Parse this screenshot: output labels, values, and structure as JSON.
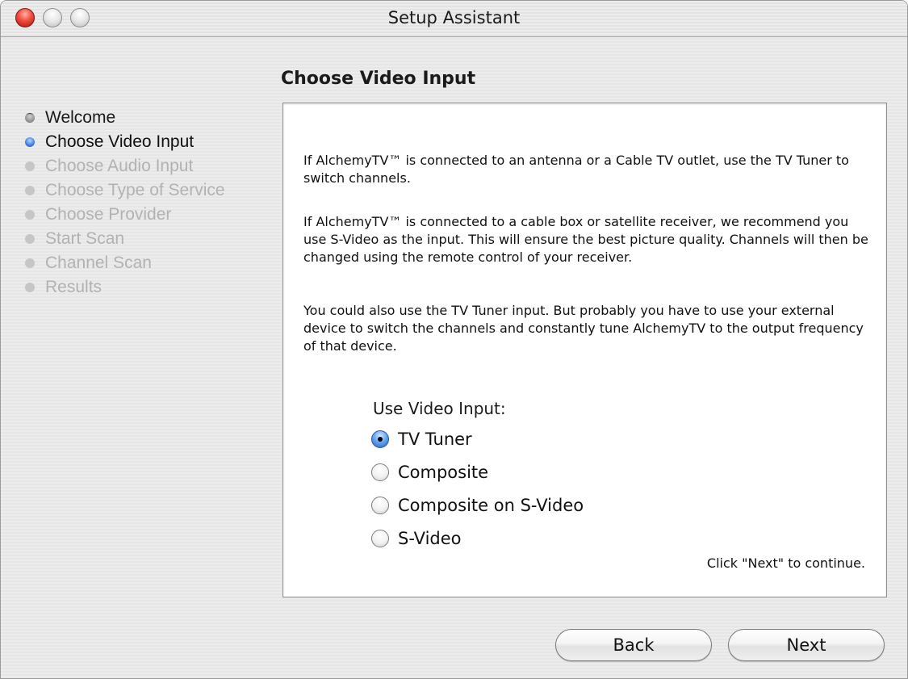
{
  "window": {
    "title": "Setup Assistant"
  },
  "page": {
    "title": "Choose Video Input"
  },
  "steps": [
    {
      "label": "Welcome",
      "state": "done"
    },
    {
      "label": "Choose Video Input",
      "state": "current"
    },
    {
      "label": "Choose Audio Input",
      "state": "pending"
    },
    {
      "label": "Choose Type of Service",
      "state": "pending"
    },
    {
      "label": "Choose Provider",
      "state": "pending"
    },
    {
      "label": "Start Scan",
      "state": "pending"
    },
    {
      "label": "Channel Scan",
      "state": "pending"
    },
    {
      "label": "Results",
      "state": "pending"
    }
  ],
  "content": {
    "paragraphs": [
      "If AlchemyTV™ is connected to an antenna or a Cable TV outlet, use the TV Tuner to switch channels.",
      "If AlchemyTV™ is connected to a cable box or satellite receiver, we recommend you use S-Video as the input. This will ensure the best picture quality. Channels will then be changed using the remote control of your receiver.",
      "You could also use the TV Tuner input. But probably you have to use your external device to switch the channels and constantly tune AlchemyTV to the output frequency of that device."
    ],
    "radio_title": "Use Video Input:",
    "options": [
      {
        "label": "TV Tuner",
        "selected": true
      },
      {
        "label": "Composite",
        "selected": false
      },
      {
        "label": "Composite on S-Video",
        "selected": false
      },
      {
        "label": "S-Video",
        "selected": false
      }
    ],
    "hint": "Click \"Next\" to continue."
  },
  "buttons": {
    "back": "Back",
    "next": "Next"
  },
  "colors": {
    "close_button": "#f04b3c",
    "selected_radio": "#3d7ee0",
    "current_step_dot": "#3d7ee0",
    "pending_text": "#b2b2b2"
  }
}
